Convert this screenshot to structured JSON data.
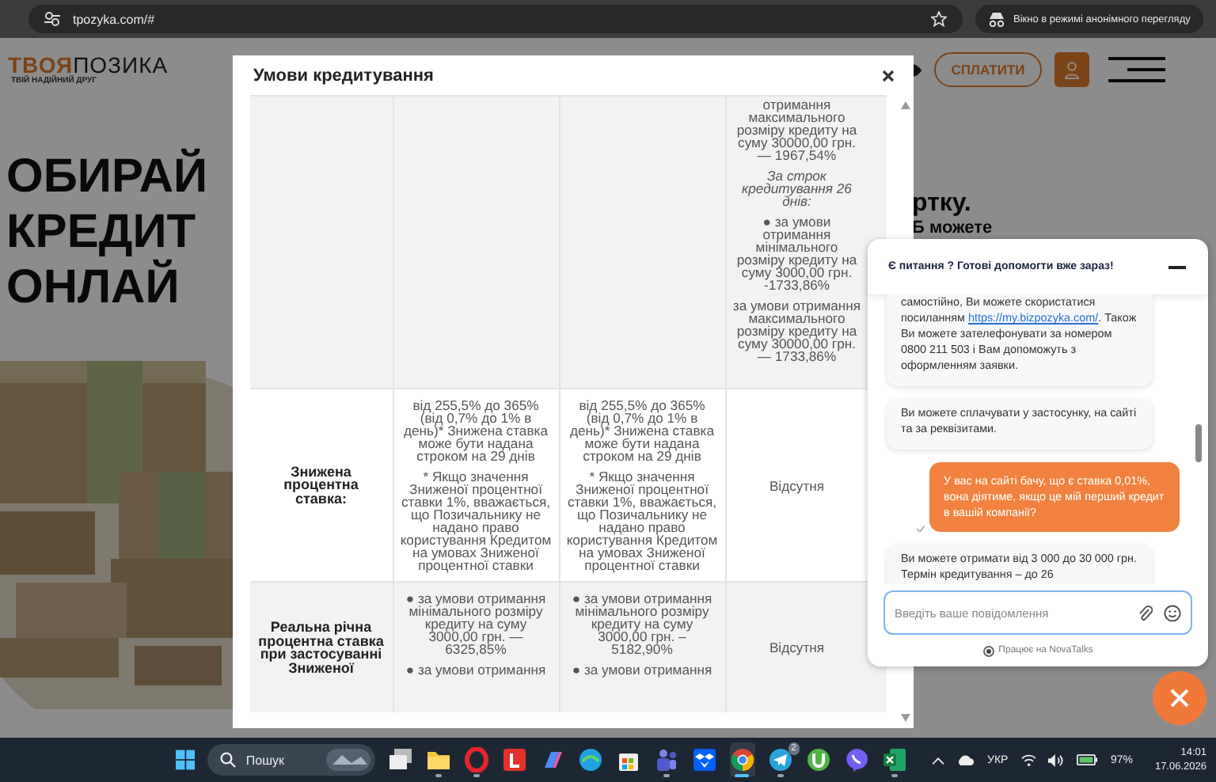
{
  "browser": {
    "url": "tpozyka.com/#",
    "incognito_label": "Вікно в режимі анонімного перегляду"
  },
  "site": {
    "logo_accent": "ТВОЯ",
    "logo_name": "ПОЗИКА",
    "tagline": "ТВІЙ НАДІЙНИЙ ДРУГ",
    "pay_button": "СПЛАТИТИ",
    "hero_lines": [
      "ОБИРАЙ",
      "КРЕДИТ",
      "ОНЛАЙ"
    ],
    "card_lines": [
      "ртку.",
      "Б можете"
    ]
  },
  "modal": {
    "title": "Умови кредитування",
    "rows": [
      {
        "shaded": true,
        "cells": [
          {
            "kind": "empty"
          },
          {
            "kind": "empty"
          },
          {
            "kind": "empty"
          },
          {
            "kind": "text",
            "paragraphs": [
              {
                "text": "отримання максимального розміру кредиту на суму 30000,00 грн. — 1967,54%",
                "italic": false
              },
              {
                "text": "За строк кредитування 26 днів:",
                "italic": true
              },
              {
                "text": "● за умови отримання мінімального розміру кредиту на суму 3000,00 грн. -1733,86%",
                "italic": false
              },
              {
                "text": "за умови отримання максимального розміру кредиту на суму 30000,00 грн. — 1733,86%",
                "italic": false
              }
            ]
          }
        ]
      },
      {
        "shaded": false,
        "cells": [
          {
            "kind": "header",
            "paragraphs": [
              {
                "text": "Знижена процентна ставка:",
                "italic": false
              }
            ]
          },
          {
            "kind": "text",
            "paragraphs": [
              {
                "text": "від 255,5% до 365% (від 0,7% до 1% в день)* Знижена ставка може бути надана строком на 29 днів",
                "italic": false
              },
              {
                "text": "* Якщо значення Зниженої процентної ставки 1%, вважається, що Позичальнику не надано право користування Кредитом на умовах Зниженої процентної ставки",
                "italic": false
              }
            ]
          },
          {
            "kind": "text",
            "paragraphs": [
              {
                "text": "від 255,5% до 365% (від 0,7% до 1% в день)* Знижена ставка може бути надана строком на 29 днів",
                "italic": false
              },
              {
                "text": "* Якщо значення Зниженої процентної ставки 1%, вважається, що Позичальнику не надано право користування Кредитом на умовах Зниженої процентної ставки",
                "italic": false
              }
            ]
          },
          {
            "kind": "text",
            "paragraphs": [
              {
                "text": "Відсутня",
                "italic": false
              }
            ]
          }
        ]
      },
      {
        "shaded": true,
        "cells": [
          {
            "kind": "header",
            "paragraphs": [
              {
                "text": "Реальна річна процентна ставка при застосуванні Зниженої",
                "italic": false
              }
            ]
          },
          {
            "kind": "text",
            "paragraphs": [
              {
                "text": "● за умови отримання мінімального розміру кредиту на суму 3000,00 грн. — 6325,85%",
                "italic": false
              },
              {
                "text": "● за умови отримання",
                "italic": false
              }
            ]
          },
          {
            "kind": "text",
            "paragraphs": [
              {
                "text": "● за умови отримання мінімального розміру кредиту на суму 3000,00 грн. – 5182,90%",
                "italic": false
              },
              {
                "text": "● за умови отримання",
                "italic": false
              }
            ]
          },
          {
            "kind": "text",
            "paragraphs": [
              {
                "text": "Відсутня",
                "italic": false
              }
            ]
          }
        ]
      }
    ]
  },
  "chat": {
    "header": "Є питання ? Готові допомогти вже зараз!",
    "messages": [
      {
        "kind": "bot",
        "text": "самостійно, Ви можете скористатися посиланням",
        "link": "https://my.bizpozyka.com/",
        "text_after": ". Також Ви можете зателефонувати за номером 0800 211 503 і Вам допоможуть з оформленням заявки."
      },
      {
        "kind": "bot",
        "text": "Ви можете сплачувати у застосунку, на сайті та за реквізитами."
      },
      {
        "kind": "user",
        "text": "У вас на сайті бачу, що є ставка 0,01%, вона діятиме, якщо це мій перший кредит в вашій компанії?"
      },
      {
        "kind": "bot",
        "text": "Ви можете отримати від 3 000 до 30 000 грн. Термін кредитування – до 26"
      }
    ],
    "placeholder": "Введіть ваше повідомлення",
    "powered_by": "Працює на NovaTalks"
  },
  "taskbar": {
    "search_placeholder": "Пошук",
    "apps": [
      {
        "kind": "taskview",
        "running": false,
        "active": false
      },
      {
        "kind": "folder",
        "running": true,
        "active": false
      },
      {
        "kind": "ring",
        "running": true,
        "active": false
      },
      {
        "kind": "tile",
        "running": false,
        "active": false
      },
      {
        "kind": "swirl",
        "running": false,
        "active": false
      },
      {
        "kind": "wave",
        "running": false,
        "active": false
      },
      {
        "kind": "bag",
        "running": false,
        "active": false
      },
      {
        "kind": "people",
        "running": true,
        "active": false
      },
      {
        "kind": "box",
        "running": false,
        "active": false
      },
      {
        "kind": "browser",
        "running": true,
        "active": true
      },
      {
        "kind": "plane",
        "running": true,
        "active": false,
        "badge": "2"
      },
      {
        "kind": "torrent",
        "running": false,
        "active": false
      },
      {
        "kind": "phone",
        "running": false,
        "active": false
      },
      {
        "kind": "sheet",
        "running": true,
        "active": false
      }
    ],
    "language": "УКР",
    "battery": "97%",
    "time": "14:01",
    "date": "17.06.2026"
  }
}
